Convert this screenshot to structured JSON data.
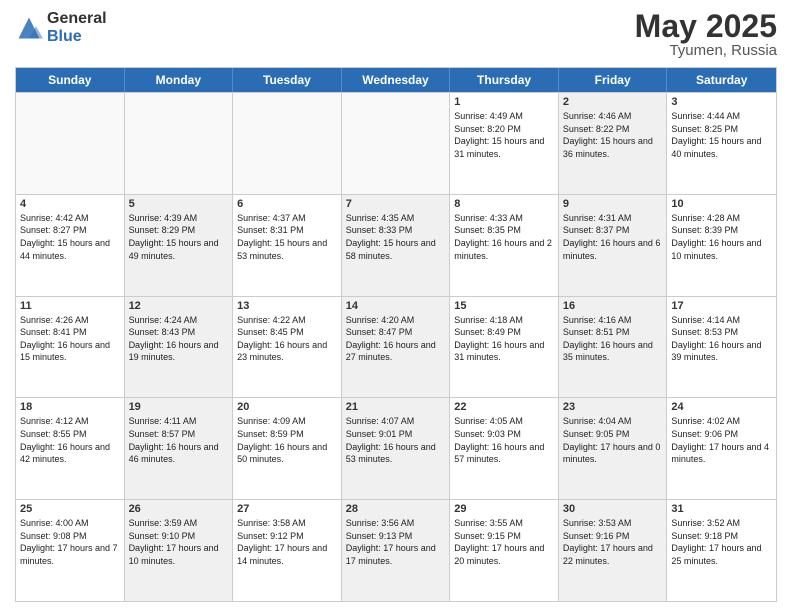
{
  "header": {
    "logo_general": "General",
    "logo_blue": "Blue",
    "title_month": "May 2025",
    "title_location": "Tyumen, Russia"
  },
  "weekdays": [
    "Sunday",
    "Monday",
    "Tuesday",
    "Wednesday",
    "Thursday",
    "Friday",
    "Saturday"
  ],
  "rows": [
    [
      {
        "day": "",
        "info": "",
        "shaded": false,
        "empty": true
      },
      {
        "day": "",
        "info": "",
        "shaded": false,
        "empty": true
      },
      {
        "day": "",
        "info": "",
        "shaded": false,
        "empty": true
      },
      {
        "day": "",
        "info": "",
        "shaded": false,
        "empty": true
      },
      {
        "day": "1",
        "info": "Sunrise: 4:49 AM\nSunset: 8:20 PM\nDaylight: 15 hours\nand 31 minutes.",
        "shaded": false,
        "empty": false
      },
      {
        "day": "2",
        "info": "Sunrise: 4:46 AM\nSunset: 8:22 PM\nDaylight: 15 hours\nand 36 minutes.",
        "shaded": true,
        "empty": false
      },
      {
        "day": "3",
        "info": "Sunrise: 4:44 AM\nSunset: 8:25 PM\nDaylight: 15 hours\nand 40 minutes.",
        "shaded": false,
        "empty": false
      }
    ],
    [
      {
        "day": "4",
        "info": "Sunrise: 4:42 AM\nSunset: 8:27 PM\nDaylight: 15 hours\nand 44 minutes.",
        "shaded": false,
        "empty": false
      },
      {
        "day": "5",
        "info": "Sunrise: 4:39 AM\nSunset: 8:29 PM\nDaylight: 15 hours\nand 49 minutes.",
        "shaded": true,
        "empty": false
      },
      {
        "day": "6",
        "info": "Sunrise: 4:37 AM\nSunset: 8:31 PM\nDaylight: 15 hours\nand 53 minutes.",
        "shaded": false,
        "empty": false
      },
      {
        "day": "7",
        "info": "Sunrise: 4:35 AM\nSunset: 8:33 PM\nDaylight: 15 hours\nand 58 minutes.",
        "shaded": true,
        "empty": false
      },
      {
        "day": "8",
        "info": "Sunrise: 4:33 AM\nSunset: 8:35 PM\nDaylight: 16 hours\nand 2 minutes.",
        "shaded": false,
        "empty": false
      },
      {
        "day": "9",
        "info": "Sunrise: 4:31 AM\nSunset: 8:37 PM\nDaylight: 16 hours\nand 6 minutes.",
        "shaded": true,
        "empty": false
      },
      {
        "day": "10",
        "info": "Sunrise: 4:28 AM\nSunset: 8:39 PM\nDaylight: 16 hours\nand 10 minutes.",
        "shaded": false,
        "empty": false
      }
    ],
    [
      {
        "day": "11",
        "info": "Sunrise: 4:26 AM\nSunset: 8:41 PM\nDaylight: 16 hours\nand 15 minutes.",
        "shaded": false,
        "empty": false
      },
      {
        "day": "12",
        "info": "Sunrise: 4:24 AM\nSunset: 8:43 PM\nDaylight: 16 hours\nand 19 minutes.",
        "shaded": true,
        "empty": false
      },
      {
        "day": "13",
        "info": "Sunrise: 4:22 AM\nSunset: 8:45 PM\nDaylight: 16 hours\nand 23 minutes.",
        "shaded": false,
        "empty": false
      },
      {
        "day": "14",
        "info": "Sunrise: 4:20 AM\nSunset: 8:47 PM\nDaylight: 16 hours\nand 27 minutes.",
        "shaded": true,
        "empty": false
      },
      {
        "day": "15",
        "info": "Sunrise: 4:18 AM\nSunset: 8:49 PM\nDaylight: 16 hours\nand 31 minutes.",
        "shaded": false,
        "empty": false
      },
      {
        "day": "16",
        "info": "Sunrise: 4:16 AM\nSunset: 8:51 PM\nDaylight: 16 hours\nand 35 minutes.",
        "shaded": true,
        "empty": false
      },
      {
        "day": "17",
        "info": "Sunrise: 4:14 AM\nSunset: 8:53 PM\nDaylight: 16 hours\nand 39 minutes.",
        "shaded": false,
        "empty": false
      }
    ],
    [
      {
        "day": "18",
        "info": "Sunrise: 4:12 AM\nSunset: 8:55 PM\nDaylight: 16 hours\nand 42 minutes.",
        "shaded": false,
        "empty": false
      },
      {
        "day": "19",
        "info": "Sunrise: 4:11 AM\nSunset: 8:57 PM\nDaylight: 16 hours\nand 46 minutes.",
        "shaded": true,
        "empty": false
      },
      {
        "day": "20",
        "info": "Sunrise: 4:09 AM\nSunset: 8:59 PM\nDaylight: 16 hours\nand 50 minutes.",
        "shaded": false,
        "empty": false
      },
      {
        "day": "21",
        "info": "Sunrise: 4:07 AM\nSunset: 9:01 PM\nDaylight: 16 hours\nand 53 minutes.",
        "shaded": true,
        "empty": false
      },
      {
        "day": "22",
        "info": "Sunrise: 4:05 AM\nSunset: 9:03 PM\nDaylight: 16 hours\nand 57 minutes.",
        "shaded": false,
        "empty": false
      },
      {
        "day": "23",
        "info": "Sunrise: 4:04 AM\nSunset: 9:05 PM\nDaylight: 17 hours\nand 0 minutes.",
        "shaded": true,
        "empty": false
      },
      {
        "day": "24",
        "info": "Sunrise: 4:02 AM\nSunset: 9:06 PM\nDaylight: 17 hours\nand 4 minutes.",
        "shaded": false,
        "empty": false
      }
    ],
    [
      {
        "day": "25",
        "info": "Sunrise: 4:00 AM\nSunset: 9:08 PM\nDaylight: 17 hours\nand 7 minutes.",
        "shaded": false,
        "empty": false
      },
      {
        "day": "26",
        "info": "Sunrise: 3:59 AM\nSunset: 9:10 PM\nDaylight: 17 hours\nand 10 minutes.",
        "shaded": true,
        "empty": false
      },
      {
        "day": "27",
        "info": "Sunrise: 3:58 AM\nSunset: 9:12 PM\nDaylight: 17 hours\nand 14 minutes.",
        "shaded": false,
        "empty": false
      },
      {
        "day": "28",
        "info": "Sunrise: 3:56 AM\nSunset: 9:13 PM\nDaylight: 17 hours\nand 17 minutes.",
        "shaded": true,
        "empty": false
      },
      {
        "day": "29",
        "info": "Sunrise: 3:55 AM\nSunset: 9:15 PM\nDaylight: 17 hours\nand 20 minutes.",
        "shaded": false,
        "empty": false
      },
      {
        "day": "30",
        "info": "Sunrise: 3:53 AM\nSunset: 9:16 PM\nDaylight: 17 hours\nand 22 minutes.",
        "shaded": true,
        "empty": false
      },
      {
        "day": "31",
        "info": "Sunrise: 3:52 AM\nSunset: 9:18 PM\nDaylight: 17 hours\nand 25 minutes.",
        "shaded": false,
        "empty": false
      }
    ]
  ]
}
